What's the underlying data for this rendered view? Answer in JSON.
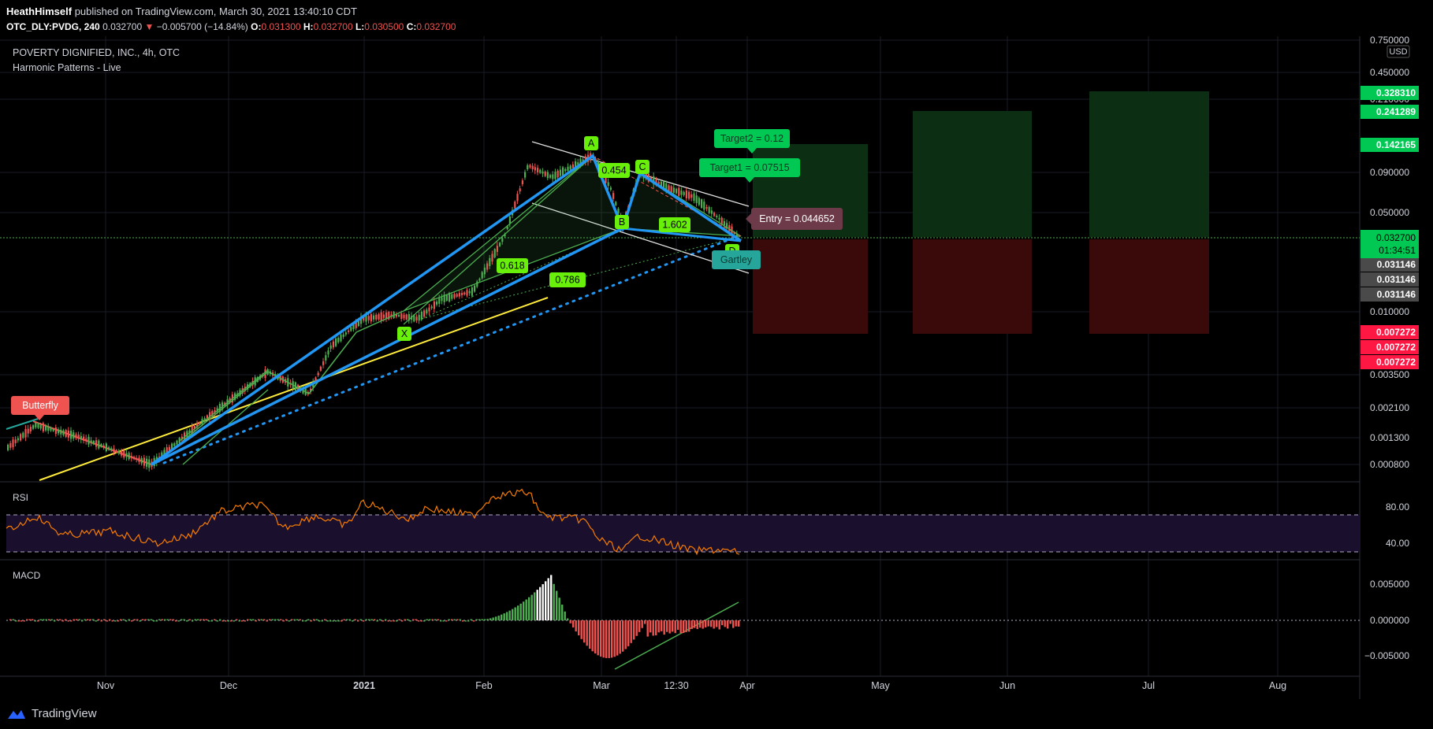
{
  "header": {
    "author": "HeathHimself",
    "published_text": "published on TradingView.com, March 30, 2021 13:40:10 CDT",
    "symbol": "OTC_DLY:PVDG, 240",
    "last": "0.032700",
    "change": "−0.005700 (−14.84%)",
    "o_label": "O:",
    "o_value": "0.031300",
    "h_label": "H:",
    "h_value": "0.032700",
    "l_label": "L:",
    "l_value": "0.030500",
    "c_label": "C:",
    "c_value": "0.032700"
  },
  "legend": {
    "title": "POVERTY DIGNIFIED, INC., 4h, OTC",
    "indicator": "Harmonic Patterns - Live"
  },
  "footer": {
    "brand": "TradingView"
  },
  "colors": {
    "up": "#26a69a",
    "up_candle": "#4caf50",
    "down": "#ef5350",
    "pattern_blue": "#2196f3",
    "pattern_green": "#4caf50",
    "label_green": "#69f00a",
    "target_green": "#00c853",
    "entry_bg": "#6d3a4a",
    "rsi_line": "#f57c00",
    "rsi_band": "#1b0f2e",
    "yellow": "#ffeb3b",
    "white_line": "#e0e0e0"
  },
  "chart_data": [
    {
      "type": "candlestick",
      "title": "POVERTY DIGNIFIED, INC., 4h, OTC",
      "scale": "log",
      "currency": "USD",
      "y_ticks": [
        "0.750000",
        "0.450000",
        "0.210000",
        "0.090000",
        "0.050000",
        "0.010000",
        "0.003500",
        "0.002100",
        "0.001300",
        "0.000800"
      ],
      "x_ticks": [
        "Nov",
        "Dec",
        "2021",
        "Feb",
        "Mar",
        "12:30",
        "Apr",
        "May",
        "Jun",
        "Jul",
        "Aug"
      ],
      "last_price": "0.032700",
      "countdown": "01:34:51",
      "price_badges": [
        {
          "value": "0.328310",
          "kind": "target"
        },
        {
          "value": "0.241289",
          "kind": "target"
        },
        {
          "value": "0.142165",
          "kind": "target"
        },
        {
          "value": "0.031146",
          "kind": "entry"
        },
        {
          "value": "0.031146",
          "kind": "entry"
        },
        {
          "value": "0.031146",
          "kind": "entry"
        },
        {
          "value": "0.007272",
          "kind": "stop"
        },
        {
          "value": "0.007272",
          "kind": "stop"
        },
        {
          "value": "0.007272",
          "kind": "stop"
        }
      ],
      "pattern_points": [
        "X",
        "A",
        "B",
        "C",
        "D"
      ],
      "ratio_labels": [
        "0.454",
        "1.602",
        "0.618",
        "0.786"
      ],
      "targets": [
        "Target2 = 0.12",
        "Target1 = 0.07515"
      ],
      "entry": "Entry = 0.044652",
      "pattern_names": [
        "Gartley",
        "Butterfly"
      ]
    },
    {
      "type": "line",
      "name": "RSI",
      "y_ticks": [
        "80.00",
        "40.00"
      ],
      "band": [
        30,
        70
      ]
    },
    {
      "type": "bar",
      "name": "MACD",
      "y_ticks": [
        "0.005000",
        "0.000000",
        "−0.005000"
      ]
    }
  ]
}
